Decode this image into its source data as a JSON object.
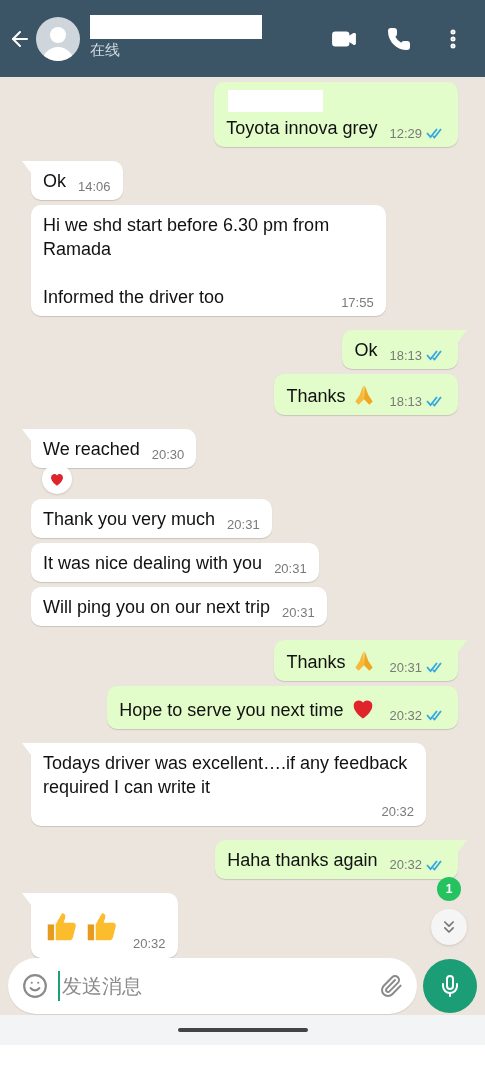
{
  "header": {
    "status": "在线"
  },
  "messages": [
    {
      "kind": "out",
      "tail": false,
      "redacted_quote": true,
      "text": "Toyota innova grey",
      "time": "12:29",
      "read": true
    },
    {
      "kind": "in",
      "tail": true,
      "text": "Ok",
      "time": "14:06"
    },
    {
      "kind": "in",
      "tail": false,
      "text": "Hi we shd start before 6.30 pm from\nRamada\n\nInformed the driver too",
      "time": "17:55"
    },
    {
      "kind": "out",
      "tail": true,
      "text": "Ok",
      "time": "18:13",
      "read": true
    },
    {
      "kind": "out",
      "tail": false,
      "text": "Thanks",
      "emoji": {
        "kind": "pray"
      },
      "time": "18:13",
      "read": true
    },
    {
      "kind": "in",
      "tail": true,
      "text": "We reached",
      "time": "20:30",
      "reaction": {
        "kind": "heart"
      }
    },
    {
      "kind": "in",
      "tail": false,
      "text": "Thank you very much",
      "time": "20:31"
    },
    {
      "kind": "in",
      "tail": false,
      "text": "It was nice dealing with you",
      "time": "20:31"
    },
    {
      "kind": "in",
      "tail": false,
      "text": "Will ping you on our next trip",
      "time": "20:31"
    },
    {
      "kind": "out",
      "tail": true,
      "text": "Thanks",
      "emoji": {
        "kind": "pray"
      },
      "time": "20:31",
      "read": true
    },
    {
      "kind": "out",
      "tail": false,
      "text": "Hope to serve you next time",
      "emoji": {
        "kind": "heart"
      },
      "time": "20:32",
      "read": true
    },
    {
      "kind": "in",
      "tail": true,
      "text": "Todays driver was excellent….if any feedback required I can write it",
      "time": "20:32"
    },
    {
      "kind": "out",
      "tail": true,
      "text": "Haha thanks again",
      "time": "20:32",
      "read": true
    },
    {
      "kind": "in",
      "tail": true,
      "stickers": [
        {
          "kind": "thumbs_up"
        },
        {
          "kind": "thumbs_up"
        }
      ],
      "time": "20:32"
    }
  ],
  "unread_badge": "1",
  "composer": {
    "placeholder": "发送消息"
  }
}
